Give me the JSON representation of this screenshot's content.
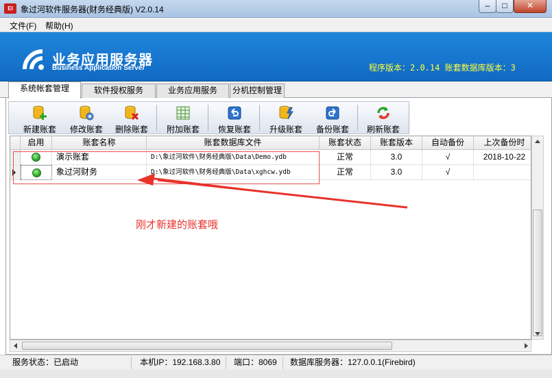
{
  "window": {
    "app_icon_text": "EI",
    "title": "象过河软件服务器(财务经典版) V2.0.14",
    "minimize": "–",
    "maximize": "□",
    "close": "✕"
  },
  "menu": {
    "file": "文件(F)",
    "help": "帮助(H)"
  },
  "banner": {
    "title": "业务应用服务器",
    "subtitle": "Business Application Server",
    "version_info": "程序版本：2.0.14  账套数据库版本：3"
  },
  "tabs": [
    {
      "label": "系统帐套管理",
      "active": true
    },
    {
      "label": "软件授权服务",
      "active": false
    },
    {
      "label": "业务应用服务",
      "active": false
    },
    {
      "label": "分机控制管理",
      "active": false
    }
  ],
  "toolbar": [
    {
      "label": "新建账套",
      "icon": "new-account-icon"
    },
    {
      "label": "修改账套",
      "icon": "edit-account-icon"
    },
    {
      "label": "删除账套",
      "icon": "delete-account-icon"
    },
    {
      "label": "附加账套",
      "icon": "attach-account-icon"
    },
    {
      "label": "恢复账套",
      "icon": "restore-account-icon"
    },
    {
      "label": "升级账套",
      "icon": "upgrade-account-icon"
    },
    {
      "label": "备份账套",
      "icon": "backup-account-icon"
    },
    {
      "label": "刷新账套",
      "icon": "refresh-account-icon"
    }
  ],
  "grid": {
    "columns": [
      "启用",
      "账套名称",
      "账套数据库文件",
      "账套状态",
      "账套版本",
      "自动备份",
      "上次备份时"
    ],
    "rows": [
      {
        "enabled": true,
        "name": "演示账套",
        "file": "D:\\象过河软件\\财务经典版\\Data\\Demo.ydb",
        "status": "正常",
        "version": "3.0",
        "auto_backup": "√",
        "last_backup": "2018-10-22",
        "current": false
      },
      {
        "enabled": true,
        "name": "象过河财务",
        "file": "D:\\象过河软件\\财务经典版\\Data\\xghcw.ydb",
        "status": "正常",
        "version": "3.0",
        "auto_backup": "√",
        "last_backup": "",
        "current": true
      }
    ]
  },
  "annotation": {
    "text": "刚才新建的账套哦",
    "color": "#e8322a"
  },
  "statusbar": {
    "service": "服务状态：已启动",
    "ip": "本机IP：192.168.3.80",
    "port": "端口：8069",
    "db_server": "数据库服务器：127.0.0.1(Firebird)"
  },
  "colors": {
    "banner": "#1a7bd3",
    "version_text": "#ffff3a",
    "enabled_dot": "#2ea82a"
  }
}
